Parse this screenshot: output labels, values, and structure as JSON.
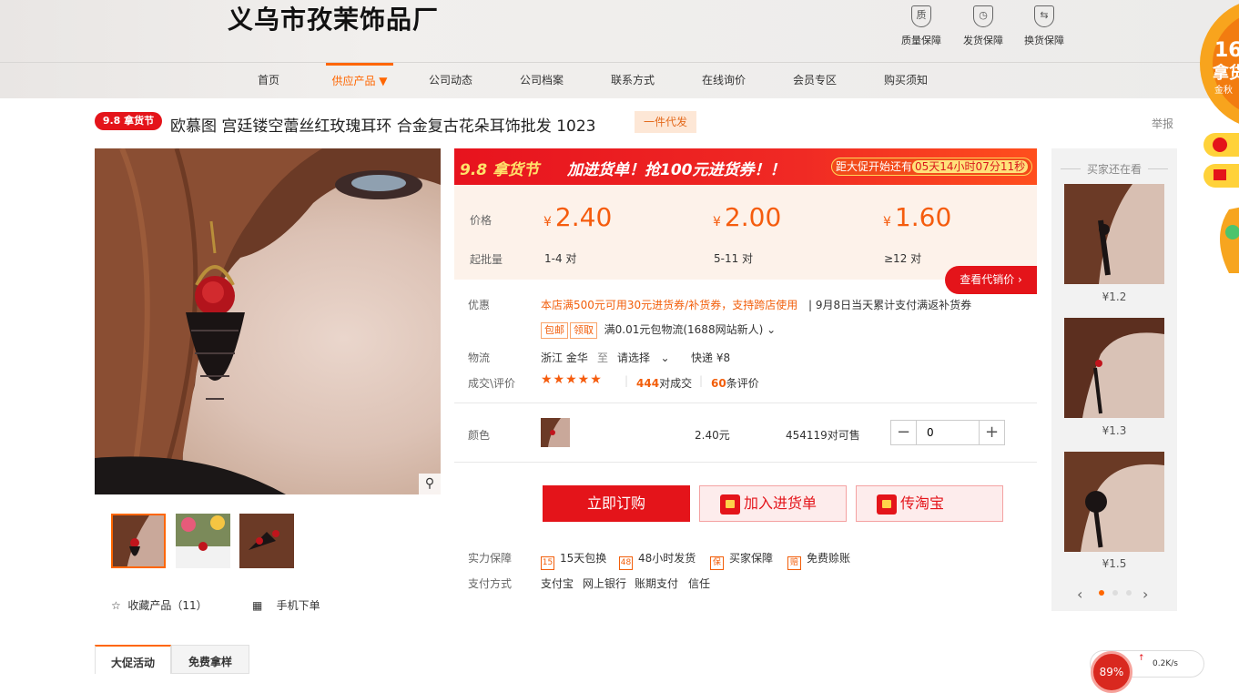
{
  "header": {
    "company_name": "义乌市孜茉饰品厂",
    "guarantees": [
      {
        "icon": "quality-shield-icon",
        "glyph": "质",
        "label": "质量保障"
      },
      {
        "icon": "delivery-clock-icon",
        "glyph": "◷",
        "label": "发货保障"
      },
      {
        "icon": "exchange-icon",
        "glyph": "⇆",
        "label": "换货保障"
      }
    ]
  },
  "nav": {
    "items": [
      {
        "label": "首页"
      },
      {
        "label": "供应产品 ▼"
      },
      {
        "label": "公司动态"
      },
      {
        "label": "公司档案"
      },
      {
        "label": "联系方式"
      },
      {
        "label": "在线询价"
      },
      {
        "label": "会员专区"
      },
      {
        "label": "购买须知"
      }
    ],
    "active_index": 1
  },
  "product": {
    "promo_badge": "9.8 拿货节",
    "title": "欧慕图 宫廷镂空蕾丝红玫瑰耳环 合金复古花朵耳饰批发 1023",
    "dropship_tag": "一件代发",
    "report_label": "举报"
  },
  "banner": {
    "festival": "9.8 拿货节",
    "slogan": "加进货单！抢100元进货券！！",
    "countdown_label": "距大促开始还有",
    "countdown": "05天14小时07分11秒"
  },
  "pricing": {
    "price_label": "价格",
    "qty_label": "起批量",
    "currency": "¥",
    "tiers": [
      {
        "price": "2.40",
        "range": "1-4 对"
      },
      {
        "price": "2.00",
        "range": "5-11 对"
      },
      {
        "price": "1.60",
        "range": "≥12 对"
      }
    ],
    "agent_price_button": "查看代销价 ›"
  },
  "offers": {
    "label": "优惠",
    "coupon_text": "本店满500元可用30元进货券/补货券，支持跨店使用",
    "coupon_note": "9月8日当天累计支付满返补货券",
    "tags": [
      "包邮",
      "领取"
    ],
    "shipping_offer": "满0.01元包物流(1688网站新人)"
  },
  "logistics": {
    "label": "物流",
    "origin": "浙江 金华",
    "to": "至",
    "destination": "请选择",
    "express": "快递 ¥8"
  },
  "reviews": {
    "label": "成交\\评价",
    "stars": "★★★★★",
    "deals_count": "444",
    "deals_suffix": "对成交",
    "reviews_count": "60",
    "reviews_suffix": "条评价"
  },
  "sku": {
    "label": "颜色",
    "price": "2.40元",
    "stock": "454119对可售",
    "quantity": "0"
  },
  "actions": {
    "order": "立即订购",
    "cart": "加入进货单",
    "taobao": "传淘宝"
  },
  "services": {
    "label": "实力保障",
    "items": [
      {
        "icon": "15-days-icon",
        "glyph": "15",
        "label": "15天包换"
      },
      {
        "icon": "48-hours-icon",
        "glyph": "48",
        "label": "48小时发货"
      },
      {
        "icon": "buyer-protection-icon",
        "glyph": "保",
        "label": "买家保障"
      },
      {
        "icon": "free-compensation-icon",
        "glyph": "赔",
        "label": "免费赊账"
      }
    ]
  },
  "payment": {
    "label": "支付方式",
    "methods": [
      "支付宝",
      "网上银行",
      "账期支付",
      "信任"
    ]
  },
  "gallery": {
    "favorite": "收藏产品（11）",
    "mobile_order": "手机下单"
  },
  "sidebar": {
    "title": "买家还在看",
    "items": [
      {
        "price": "¥1.2"
      },
      {
        "price": "¥1.3"
      },
      {
        "price": "¥1.5"
      }
    ]
  },
  "tabs": [
    "大促活动",
    "免费拿样"
  ],
  "speed_widget": {
    "percent": "89%",
    "rate": "0.2K/s"
  },
  "colors": {
    "accent": "#f60",
    "price": "#f55c0e",
    "brand_red": "#e4141a"
  }
}
